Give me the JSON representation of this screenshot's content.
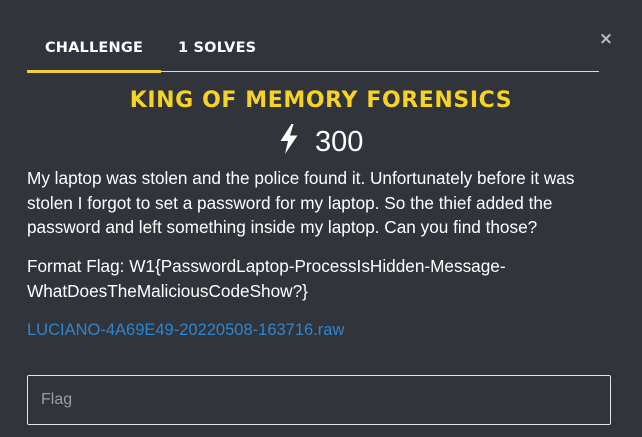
{
  "modal": {
    "close_glyph": "×",
    "tabs": [
      {
        "label": "Challenge",
        "active": true
      },
      {
        "label": "1 Solves",
        "active": false
      }
    ],
    "challenge_name": "King of Memory Forensics",
    "points": "300",
    "points_icon": "lightning-bolt-icon",
    "description": "My laptop was stolen and the police found it. Unfortunately before it was stolen I forgot to set a password for my laptop. So the thief added the password and left something inside my laptop. Can you find those?",
    "format_flag_line1": "Format Flag: W1{PasswordLaptop-ProcessIsHidden-Message-",
    "format_flag_line2": "WhatDoesTheMaliciousCodeShow?}",
    "file_link": "LUCIANO-4A69E49-20220508-163716.raw",
    "flag_placeholder": "Flag"
  },
  "colors": {
    "background": "#31343a",
    "accent_yellow": "#f7d322",
    "tab_underline": "#f5cf36",
    "link_blue": "#2e86cf",
    "text": "#ffffff"
  }
}
